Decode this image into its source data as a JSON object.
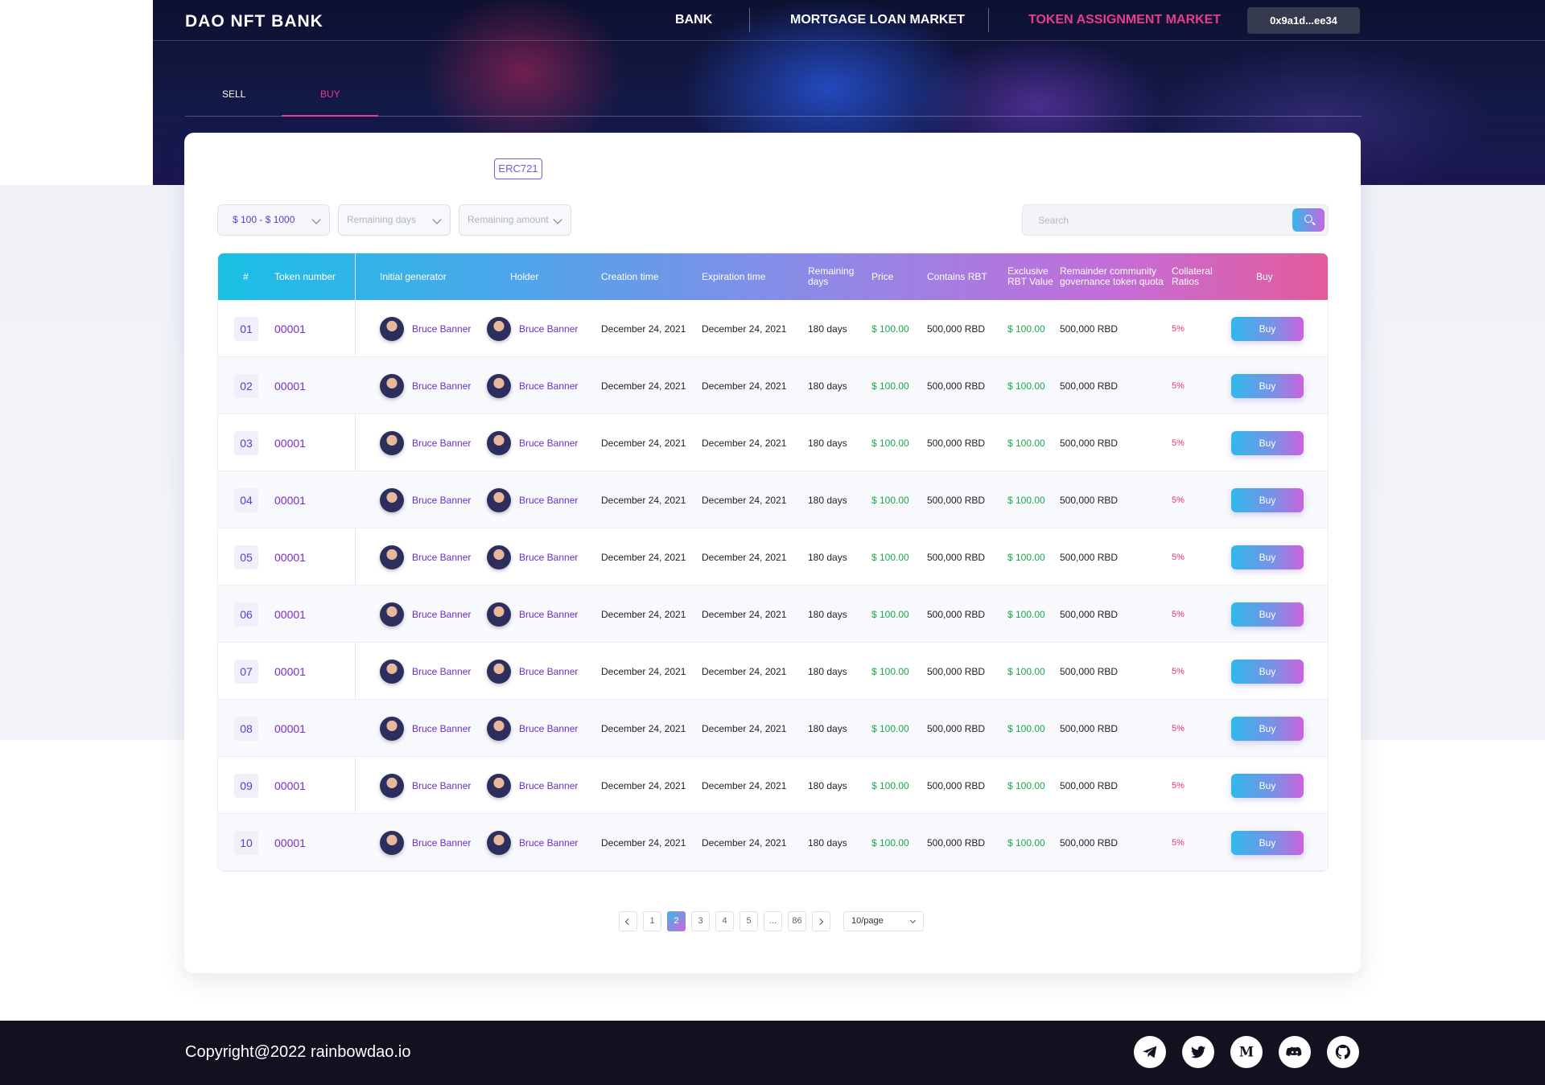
{
  "header": {
    "logo": "DAO NFT BANK",
    "nav": [
      {
        "label": "BANK"
      },
      {
        "label": "MORTGAGE LOAN MARKET"
      },
      {
        "label": "TOKEN ASSIGNMENT MARKET",
        "active": true
      }
    ],
    "wallet": "0x9a1d...ee34"
  },
  "tabs": [
    {
      "label": "SELL"
    },
    {
      "label": "BUY",
      "active": true
    }
  ],
  "badge": "ERC721",
  "filters": {
    "price_range": "$ 100 - $ 1000",
    "remaining_days": "Remaining days",
    "remaining_amount": "Remaining amount",
    "search_placeholder": "Search"
  },
  "table": {
    "headers": {
      "idx": "#",
      "token_number": "Token number",
      "initial_generator": "Initial generator",
      "holder": "Holder",
      "creation_time": "Creation time",
      "expiration_time": "Expiration time",
      "remaining_days": "Remaining days",
      "price": "Price",
      "contains_rbt": "Contains RBT",
      "exclusive_rbt_value": "Exclusive RBT Value",
      "remainder_quota": "Remainder community governance token quota",
      "collateral_ratios": "Collateral Ratios",
      "buy": "Buy"
    },
    "rows": [
      {
        "idx": "01",
        "token": "00001",
        "generator": "Bruce Banner",
        "holder": "Bruce Banner",
        "created": "December 24, 2021",
        "expires": "December 24, 2021",
        "remaining": "180 days",
        "price": "$ 100.00",
        "rbt": "500,000 RBD",
        "exclusive": "$ 100.00",
        "quota": "500,000 RBD",
        "ratio": "5%",
        "action": "Buy"
      },
      {
        "idx": "02",
        "token": "00001",
        "generator": "Bruce Banner",
        "holder": "Bruce Banner",
        "created": "December 24, 2021",
        "expires": "December 24, 2021",
        "remaining": "180 days",
        "price": "$ 100.00",
        "rbt": "500,000 RBD",
        "exclusive": "$ 100.00",
        "quota": "500,000 RBD",
        "ratio": "5%",
        "action": "Buy"
      },
      {
        "idx": "03",
        "token": "00001",
        "generator": "Bruce Banner",
        "holder": "Bruce Banner",
        "created": "December 24, 2021",
        "expires": "December 24, 2021",
        "remaining": "180 days",
        "price": "$ 100.00",
        "rbt": "500,000 RBD",
        "exclusive": "$ 100.00",
        "quota": "500,000 RBD",
        "ratio": "5%",
        "action": "Buy"
      },
      {
        "idx": "04",
        "token": "00001",
        "generator": "Bruce Banner",
        "holder": "Bruce Banner",
        "created": "December 24, 2021",
        "expires": "December 24, 2021",
        "remaining": "180 days",
        "price": "$ 100.00",
        "rbt": "500,000 RBD",
        "exclusive": "$ 100.00",
        "quota": "500,000 RBD",
        "ratio": "5%",
        "action": "Buy"
      },
      {
        "idx": "05",
        "token": "00001",
        "generator": "Bruce Banner",
        "holder": "Bruce Banner",
        "created": "December 24, 2021",
        "expires": "December 24, 2021",
        "remaining": "180 days",
        "price": "$ 100.00",
        "rbt": "500,000 RBD",
        "exclusive": "$ 100.00",
        "quota": "500,000 RBD",
        "ratio": "5%",
        "action": "Buy"
      },
      {
        "idx": "06",
        "token": "00001",
        "generator": "Bruce Banner",
        "holder": "Bruce Banner",
        "created": "December 24, 2021",
        "expires": "December 24, 2021",
        "remaining": "180 days",
        "price": "$ 100.00",
        "rbt": "500,000 RBD",
        "exclusive": "$ 100.00",
        "quota": "500,000 RBD",
        "ratio": "5%",
        "action": "Buy"
      },
      {
        "idx": "07",
        "token": "00001",
        "generator": "Bruce Banner",
        "holder": "Bruce Banner",
        "created": "December 24, 2021",
        "expires": "December 24, 2021",
        "remaining": "180 days",
        "price": "$ 100.00",
        "rbt": "500,000 RBD",
        "exclusive": "$ 100.00",
        "quota": "500,000 RBD",
        "ratio": "5%",
        "action": "Buy"
      },
      {
        "idx": "08",
        "token": "00001",
        "generator": "Bruce Banner",
        "holder": "Bruce Banner",
        "created": "December 24, 2021",
        "expires": "December 24, 2021",
        "remaining": "180 days",
        "price": "$ 100.00",
        "rbt": "500,000 RBD",
        "exclusive": "$ 100.00",
        "quota": "500,000 RBD",
        "ratio": "5%",
        "action": "Buy"
      },
      {
        "idx": "09",
        "token": "00001",
        "generator": "Bruce Banner",
        "holder": "Bruce Banner",
        "created": "December 24, 2021",
        "expires": "December 24, 2021",
        "remaining": "180 days",
        "price": "$ 100.00",
        "rbt": "500,000 RBD",
        "exclusive": "$ 100.00",
        "quota": "500,000 RBD",
        "ratio": "5%",
        "action": "Buy"
      },
      {
        "idx": "10",
        "token": "00001",
        "generator": "Bruce Banner",
        "holder": "Bruce Banner",
        "created": "December 24, 2021",
        "expires": "December 24, 2021",
        "remaining": "180 days",
        "price": "$ 100.00",
        "rbt": "500,000 RBD",
        "exclusive": "$ 100.00",
        "quota": "500,000 RBD",
        "ratio": "5%",
        "action": "Buy"
      }
    ]
  },
  "pagination": {
    "pages": [
      "1",
      "2",
      "3",
      "4",
      "5",
      "...",
      "86"
    ],
    "current": "2",
    "page_size": "10/page"
  },
  "footer": {
    "copyright": "Copyright@2022 rainbowdao.io",
    "social": [
      "telegram-icon",
      "twitter-icon",
      "medium-icon",
      "discord-icon",
      "github-icon"
    ]
  },
  "colors": {
    "accent_pink": "#e83c8c",
    "accent_purple": "#5840c8",
    "price_green": "#18a84b"
  }
}
